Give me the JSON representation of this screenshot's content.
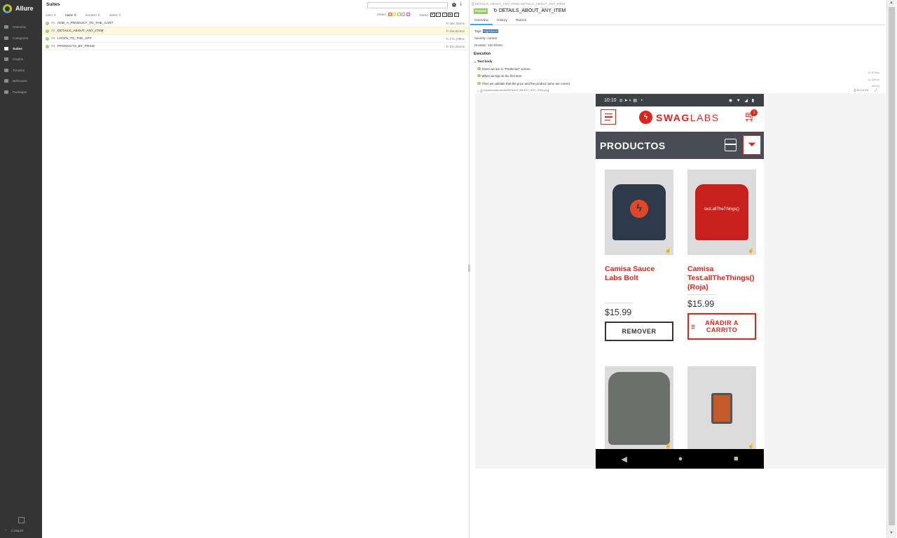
{
  "app": {
    "title": "Allure"
  },
  "sidebar": {
    "items": [
      {
        "label": "Overview",
        "icon": "overview-icon",
        "active": false
      },
      {
        "label": "Categories",
        "icon": "flag-icon",
        "active": false
      },
      {
        "label": "Suites",
        "icon": "briefcase-icon",
        "active": true
      },
      {
        "label": "Graphs",
        "icon": "bar-chart-icon",
        "active": false
      },
      {
        "label": "Timeline",
        "icon": "clock-icon",
        "active": false
      },
      {
        "label": "Behaviors",
        "icon": "list-icon",
        "active": false
      },
      {
        "label": "Packages",
        "icon": "align-left-icon",
        "active": false
      }
    ],
    "collapse_label": "Collapse"
  },
  "suites": {
    "title": "Suites",
    "sort": {
      "order": "order",
      "name": "name",
      "duration": "duration",
      "status": "status"
    },
    "status_label": "Status:",
    "marks_label": "Marks:",
    "status_colors": [
      "#fd5a3e",
      "#ffd050",
      "#97cc64",
      "#aaaaaa",
      "#d35ebe"
    ],
    "rows": [
      {
        "num": "#1",
        "name": "ADD_A_PRODUCT_TO_THE_CART",
        "duration": "19s 194ms"
      },
      {
        "num": "#2",
        "name": "DETAILS_ABOUT_ANY_ITEM",
        "duration": "18s 824ms"
      },
      {
        "num": "#3",
        "name": "LOGIN_TO_THE_APP",
        "duration": "17s 179ms"
      },
      {
        "num": "#4",
        "name": "PRODUCTS_BY_PRICE",
        "duration": "21s 251ms"
      }
    ]
  },
  "test": {
    "breadcrumb": "DETAILS_ABOUT_ANY_ITEM: DETAILS_ABOUT_ANY_ITEM",
    "status": "Passed",
    "title": "DETAILS_ABOUT_ANY_ITEM",
    "tabs": [
      "Overview",
      "History",
      "Retries"
    ],
    "tags_label": "Tags:",
    "tag": "regression",
    "severity": "Severity: normal",
    "duration": "Duration: 18s 824ms",
    "execution_label": "Execution",
    "body_label": "Test body",
    "steps": [
      {
        "text": "Given we are in \"Productos\" screen",
        "time": "2s 879ms"
      },
      {
        "text": "When we tap on the first item",
        "time": "1s 360ms"
      },
      {
        "text": "Then we validate that the price and the product name are correct",
        "time": "880ms"
      }
    ],
    "attachment": {
      "name": "reports/screenshots/DETAILS_ABOUT_ANY_ITEM.png",
      "size": "99 1.6 KB"
    }
  },
  "phone": {
    "time": "10:10",
    "brand": {
      "bold": "SWAG",
      "light": "LABS"
    },
    "cart_count": "1",
    "products_title": "PRODUCTOS",
    "cards": [
      {
        "name": "Camisa Sauce Labs Bolt",
        "price": "$15.99",
        "button": "REMOVER"
      },
      {
        "name": "Camisa Test.allTheThings() (Roja)",
        "price": "$15.99",
        "button": "AÑADIR A CARRITO"
      }
    ],
    "shirt_text": "test.allTheThings()"
  }
}
